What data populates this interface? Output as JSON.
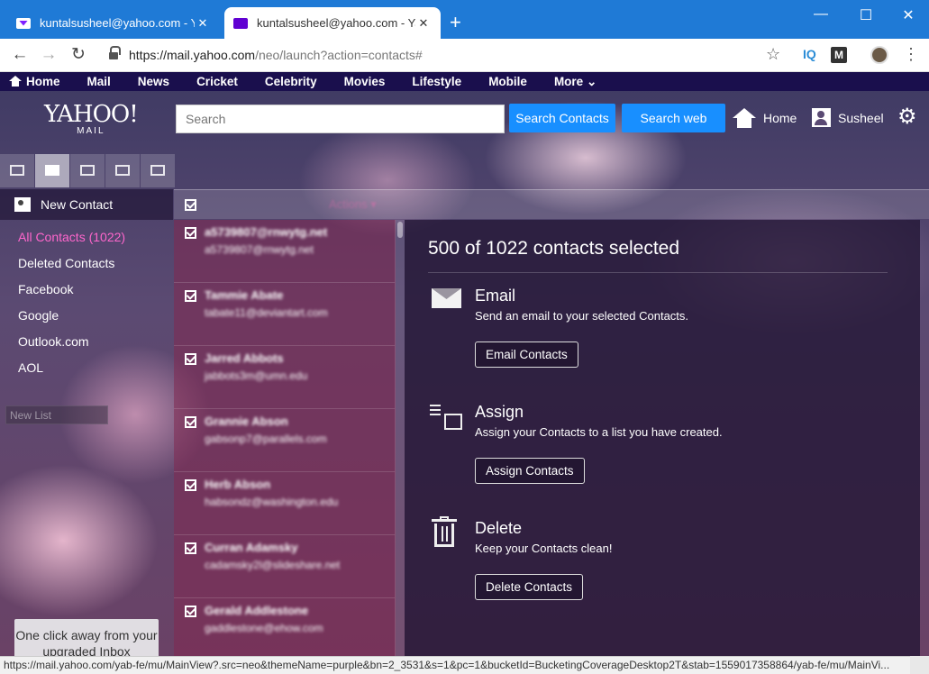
{
  "browser": {
    "tabs": [
      {
        "title": "kuntalsusheel@yahoo.com - Yahoo Mail",
        "active": false
      },
      {
        "title": "kuntalsusheel@yahoo.com - Yahoo Mail",
        "active": true
      }
    ],
    "new_tab": "+",
    "window_controls": {
      "minimize": "—",
      "maximize": "☐",
      "close": "✕"
    },
    "url_host": "https://mail.yahoo.com",
    "url_path": "/neo/launch?action=contacts#",
    "extension_iq": "IQ",
    "extension_m": "M",
    "status_url": "https://mail.yahoo.com/yab-fe/mu/MainView?.src=neo&themeName=purple&bn=2_3531&s=1&pc=1&bucketId=BucketingCoverageDesktop2T&stab=1559017358864/yab-fe/mu/MainVi..."
  },
  "topnav": {
    "items": [
      "Home",
      "Mail",
      "News",
      "Cricket",
      "Celebrity",
      "Movies",
      "Lifestyle",
      "Mobile",
      "More ⌄"
    ]
  },
  "header": {
    "logo": "YAHOO!",
    "logo_sub": "MAIL",
    "search_placeholder": "Search",
    "search_contacts": "Search Contacts",
    "search_web": "Search web",
    "home": "Home",
    "user": "Susheel",
    "settings_icon": "⚙"
  },
  "sidebar": {
    "new_contact": "New Contact",
    "items": [
      {
        "label": "All Contacts (1022)",
        "selected": true
      },
      {
        "label": "Deleted Contacts",
        "selected": false
      },
      {
        "label": "Facebook",
        "selected": false
      },
      {
        "label": "Google",
        "selected": false
      },
      {
        "label": "Outlook.com",
        "selected": false
      },
      {
        "label": "AOL",
        "selected": false
      }
    ],
    "new_list_placeholder": "New List",
    "promo": "One click away from your upgraded Inbox"
  },
  "list": {
    "actions": "Actions ▾",
    "contacts": [
      {
        "name": "a5739807@rnwytg.net",
        "email": "a5739807@rnwytg.net"
      },
      {
        "name": "Tammie Abate",
        "email": "tabate11@deviantart.com"
      },
      {
        "name": "Jarred Abbots",
        "email": "jabbots3m@umn.edu"
      },
      {
        "name": "Grannie Abson",
        "email": "gabsonp7@parallels.com"
      },
      {
        "name": "Herb Abson",
        "email": "habsondz@washington.edu"
      },
      {
        "name": "Curran Adamsky",
        "email": "cadamsky2l@slideshare.net"
      },
      {
        "name": "Gerald Addlestone",
        "email": "gaddlestone@ehow.com"
      }
    ]
  },
  "detail": {
    "heading": "500 of 1022 contacts selected",
    "sections": [
      {
        "title": "Email",
        "description": "Send an email to your selected Contacts.",
        "button": "Email Contacts"
      },
      {
        "title": "Assign",
        "description": "Assign your Contacts to a list you have created.",
        "button": "Assign Contacts"
      },
      {
        "title": "Delete",
        "description": "Keep your Contacts clean!",
        "button": "Delete Contacts"
      }
    ]
  },
  "colors": {
    "nav_bg": "#1a0f4d",
    "accent_blue": "#188fff",
    "selected_pink": "#ff66cc",
    "chrome_blue": "#1f7ad6"
  }
}
